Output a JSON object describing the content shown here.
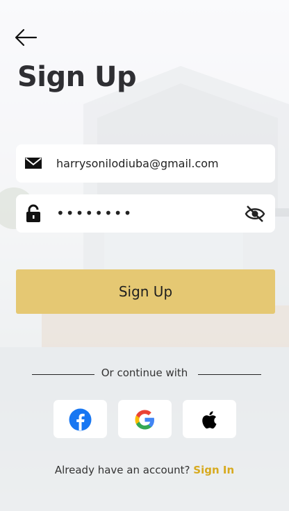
{
  "screen": {
    "title": "Sign Up"
  },
  "email": {
    "value": "harrysonilodiuba@gmail.com"
  },
  "password": {
    "masked": "••••••••"
  },
  "signup_button": {
    "label": "Sign Up"
  },
  "divider": {
    "label": "Or continue with"
  },
  "social": [
    "facebook-icon",
    "google-icon",
    "apple-icon"
  ],
  "footer": {
    "prompt": "Already have an account?",
    "link": "Sign In"
  },
  "colors": {
    "accent": "#e5c873",
    "link": "#d7aa1f",
    "facebook": "#1877f2"
  }
}
